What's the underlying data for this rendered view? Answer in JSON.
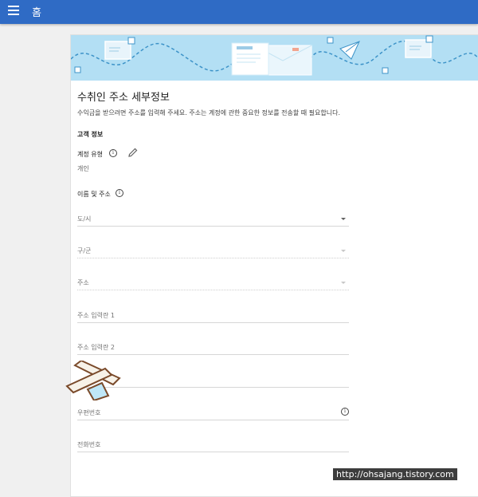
{
  "header": {
    "title": "홈"
  },
  "card": {
    "title": "수취인 주소 세부정보",
    "description": "수익금을 받으려면 주소를 입력해 주세요. 주소는 계정에 관한 중요한 정보를 전송할 때 필요합니다."
  },
  "customer_info": {
    "heading": "고객 정보",
    "account_type_label": "계정 유형",
    "account_type_value": "개인"
  },
  "name_address": {
    "heading": "이름 및 주소",
    "fields": {
      "city": "도/시",
      "district": "구/군",
      "address": "주소",
      "address1": "주소 입력란 1",
      "address2": "주소 입력란 2",
      "postal": "우편번호",
      "phone": "전화번호"
    }
  },
  "watermark": {
    "url": "http://ohsajang.tistory.com"
  },
  "colors": {
    "topbar": "#2f6bc5",
    "banner": "#b3dff4"
  },
  "icons": [
    "menu-icon",
    "info-icon",
    "pencil-icon",
    "dropdown-caret-icon",
    "envelope-icon",
    "paper-plane-icon"
  ]
}
